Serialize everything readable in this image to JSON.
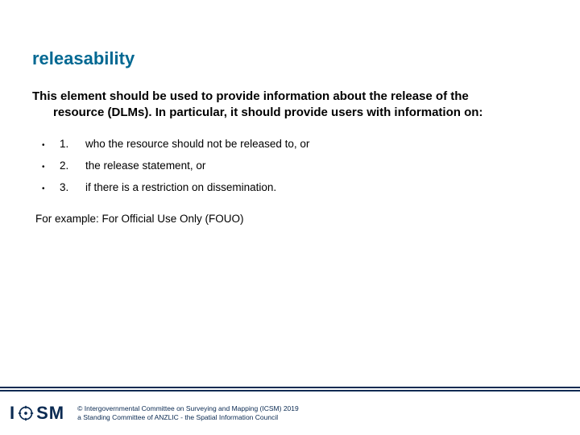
{
  "title": "releasability",
  "intro_line1": "This element should be used to provide information about the release of the",
  "intro_line2": "resource (DLMs). In particular, it should provide users with information on:",
  "items": [
    {
      "num": "1.",
      "text": "who the resource should not be released to, or"
    },
    {
      "num": "2.",
      "text": "the release statement, or"
    },
    {
      "num": "3.",
      "text": "if there is a restriction on dissemination."
    }
  ],
  "example": "For example: For Official Use Only (FOUO)",
  "logo": {
    "i": "I",
    "sm": "SM"
  },
  "copyright": {
    "line1": "© Intergovernmental Committee on Surveying and Mapping (ICSM) 2019",
    "line2": "a Standing Committee of ANZLIC - the Spatial Information Council"
  },
  "colors": {
    "accent": "#006892",
    "brand_dark": "#0a2a52"
  }
}
